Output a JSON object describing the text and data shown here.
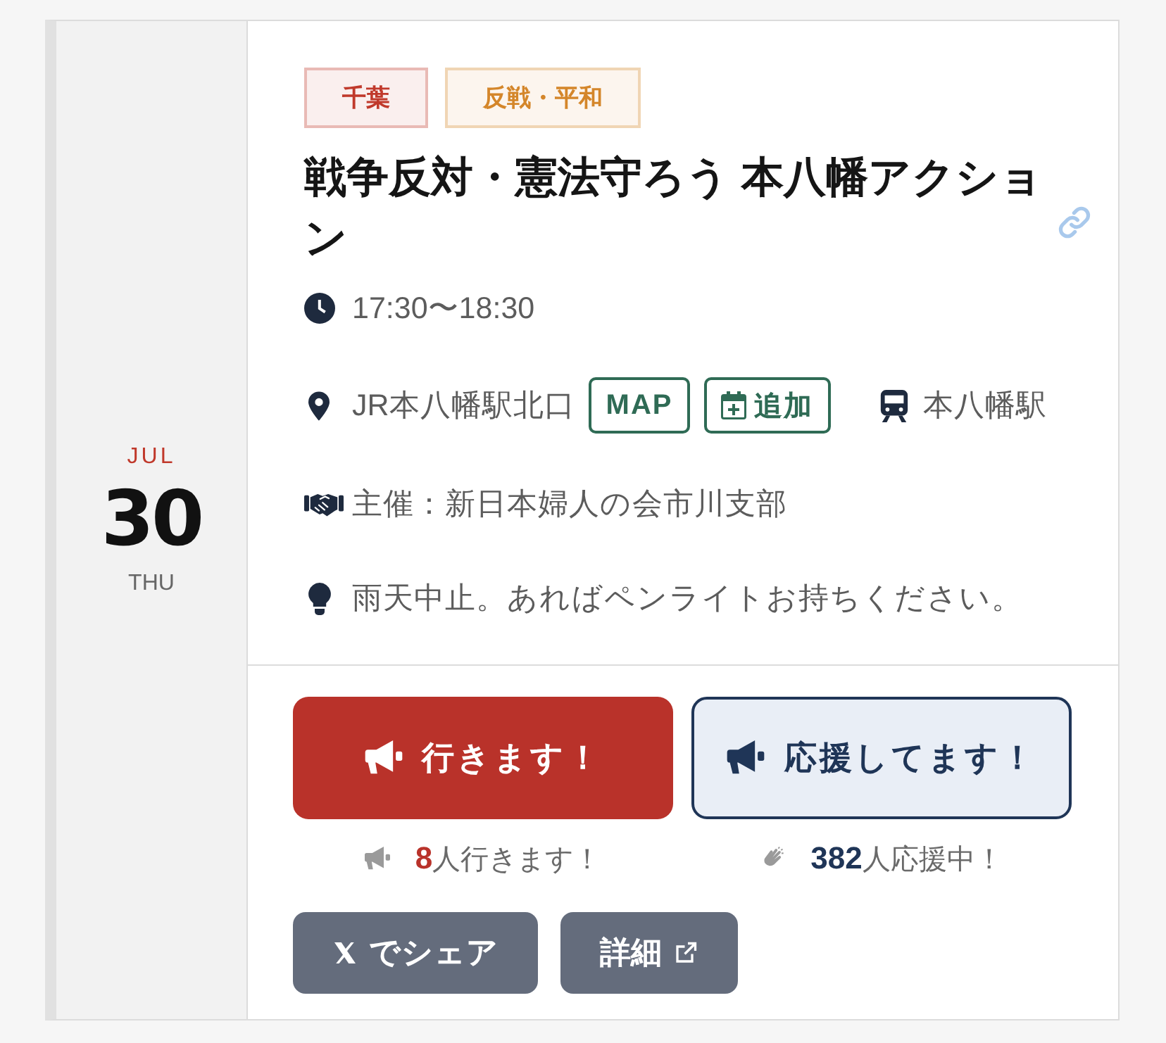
{
  "date": {
    "month": "JUL",
    "day": "30",
    "weekday": "THU"
  },
  "tags": [
    {
      "label": "千葉",
      "color": "#c0392b"
    },
    {
      "label": "反戦・平和",
      "color": "#d4862a"
    }
  ],
  "title": "戦争反対・憲法守ろう 本八幡アクション",
  "time": "17:30〜18:30",
  "location": {
    "place": "JR本八幡駅北口",
    "map_button": "MAP",
    "add_button": "追加",
    "station": "本八幡駅"
  },
  "organizer": "主催：新日本婦人の会市川支部",
  "note": "雨天中止。あればペンライトお持ちください。",
  "actions": [
    {
      "kind": "going",
      "label": "行きます！",
      "count": "**8**人行きます！"
    },
    {
      "kind": "support",
      "label": "応援してます！",
      "count": "**382**人応援中！"
    }
  ],
  "links": [
    {
      "kind": "x",
      "label": "でシェア"
    },
    {
      "kind": "details",
      "label": "詳細"
    }
  ]
}
